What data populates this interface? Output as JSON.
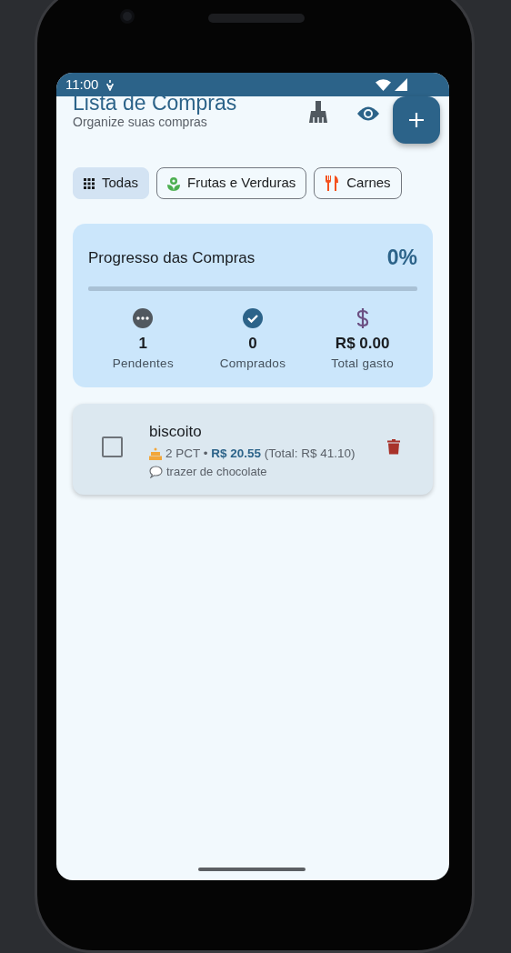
{
  "status_bar": {
    "time": "11:00"
  },
  "header": {
    "title": "Lista de Compras",
    "subtitle": "Organize suas compras"
  },
  "filters": [
    {
      "label": "Todas",
      "selected": true,
      "kind": "grid"
    },
    {
      "label": "Frutas e Verduras",
      "selected": false,
      "kind": "plant"
    },
    {
      "label": "Carnes",
      "selected": false,
      "kind": "utensils"
    }
  ],
  "progress": {
    "title": "Progresso das Compras",
    "percent": "0%",
    "level": 0
  },
  "stats": [
    {
      "kind": "pending",
      "value": "1",
      "label": "Pendentes"
    },
    {
      "kind": "done",
      "value": "0",
      "label": "Comprados"
    },
    {
      "kind": "money",
      "value": "R$ 0.00",
      "label": "Total gasto"
    }
  ],
  "items": [
    {
      "name": "biscoito",
      "checked": false,
      "details": "2 PCT • **R$ 20.55** (Total: R$ 41.10)",
      "note": "trazer de chocolate"
    }
  ]
}
